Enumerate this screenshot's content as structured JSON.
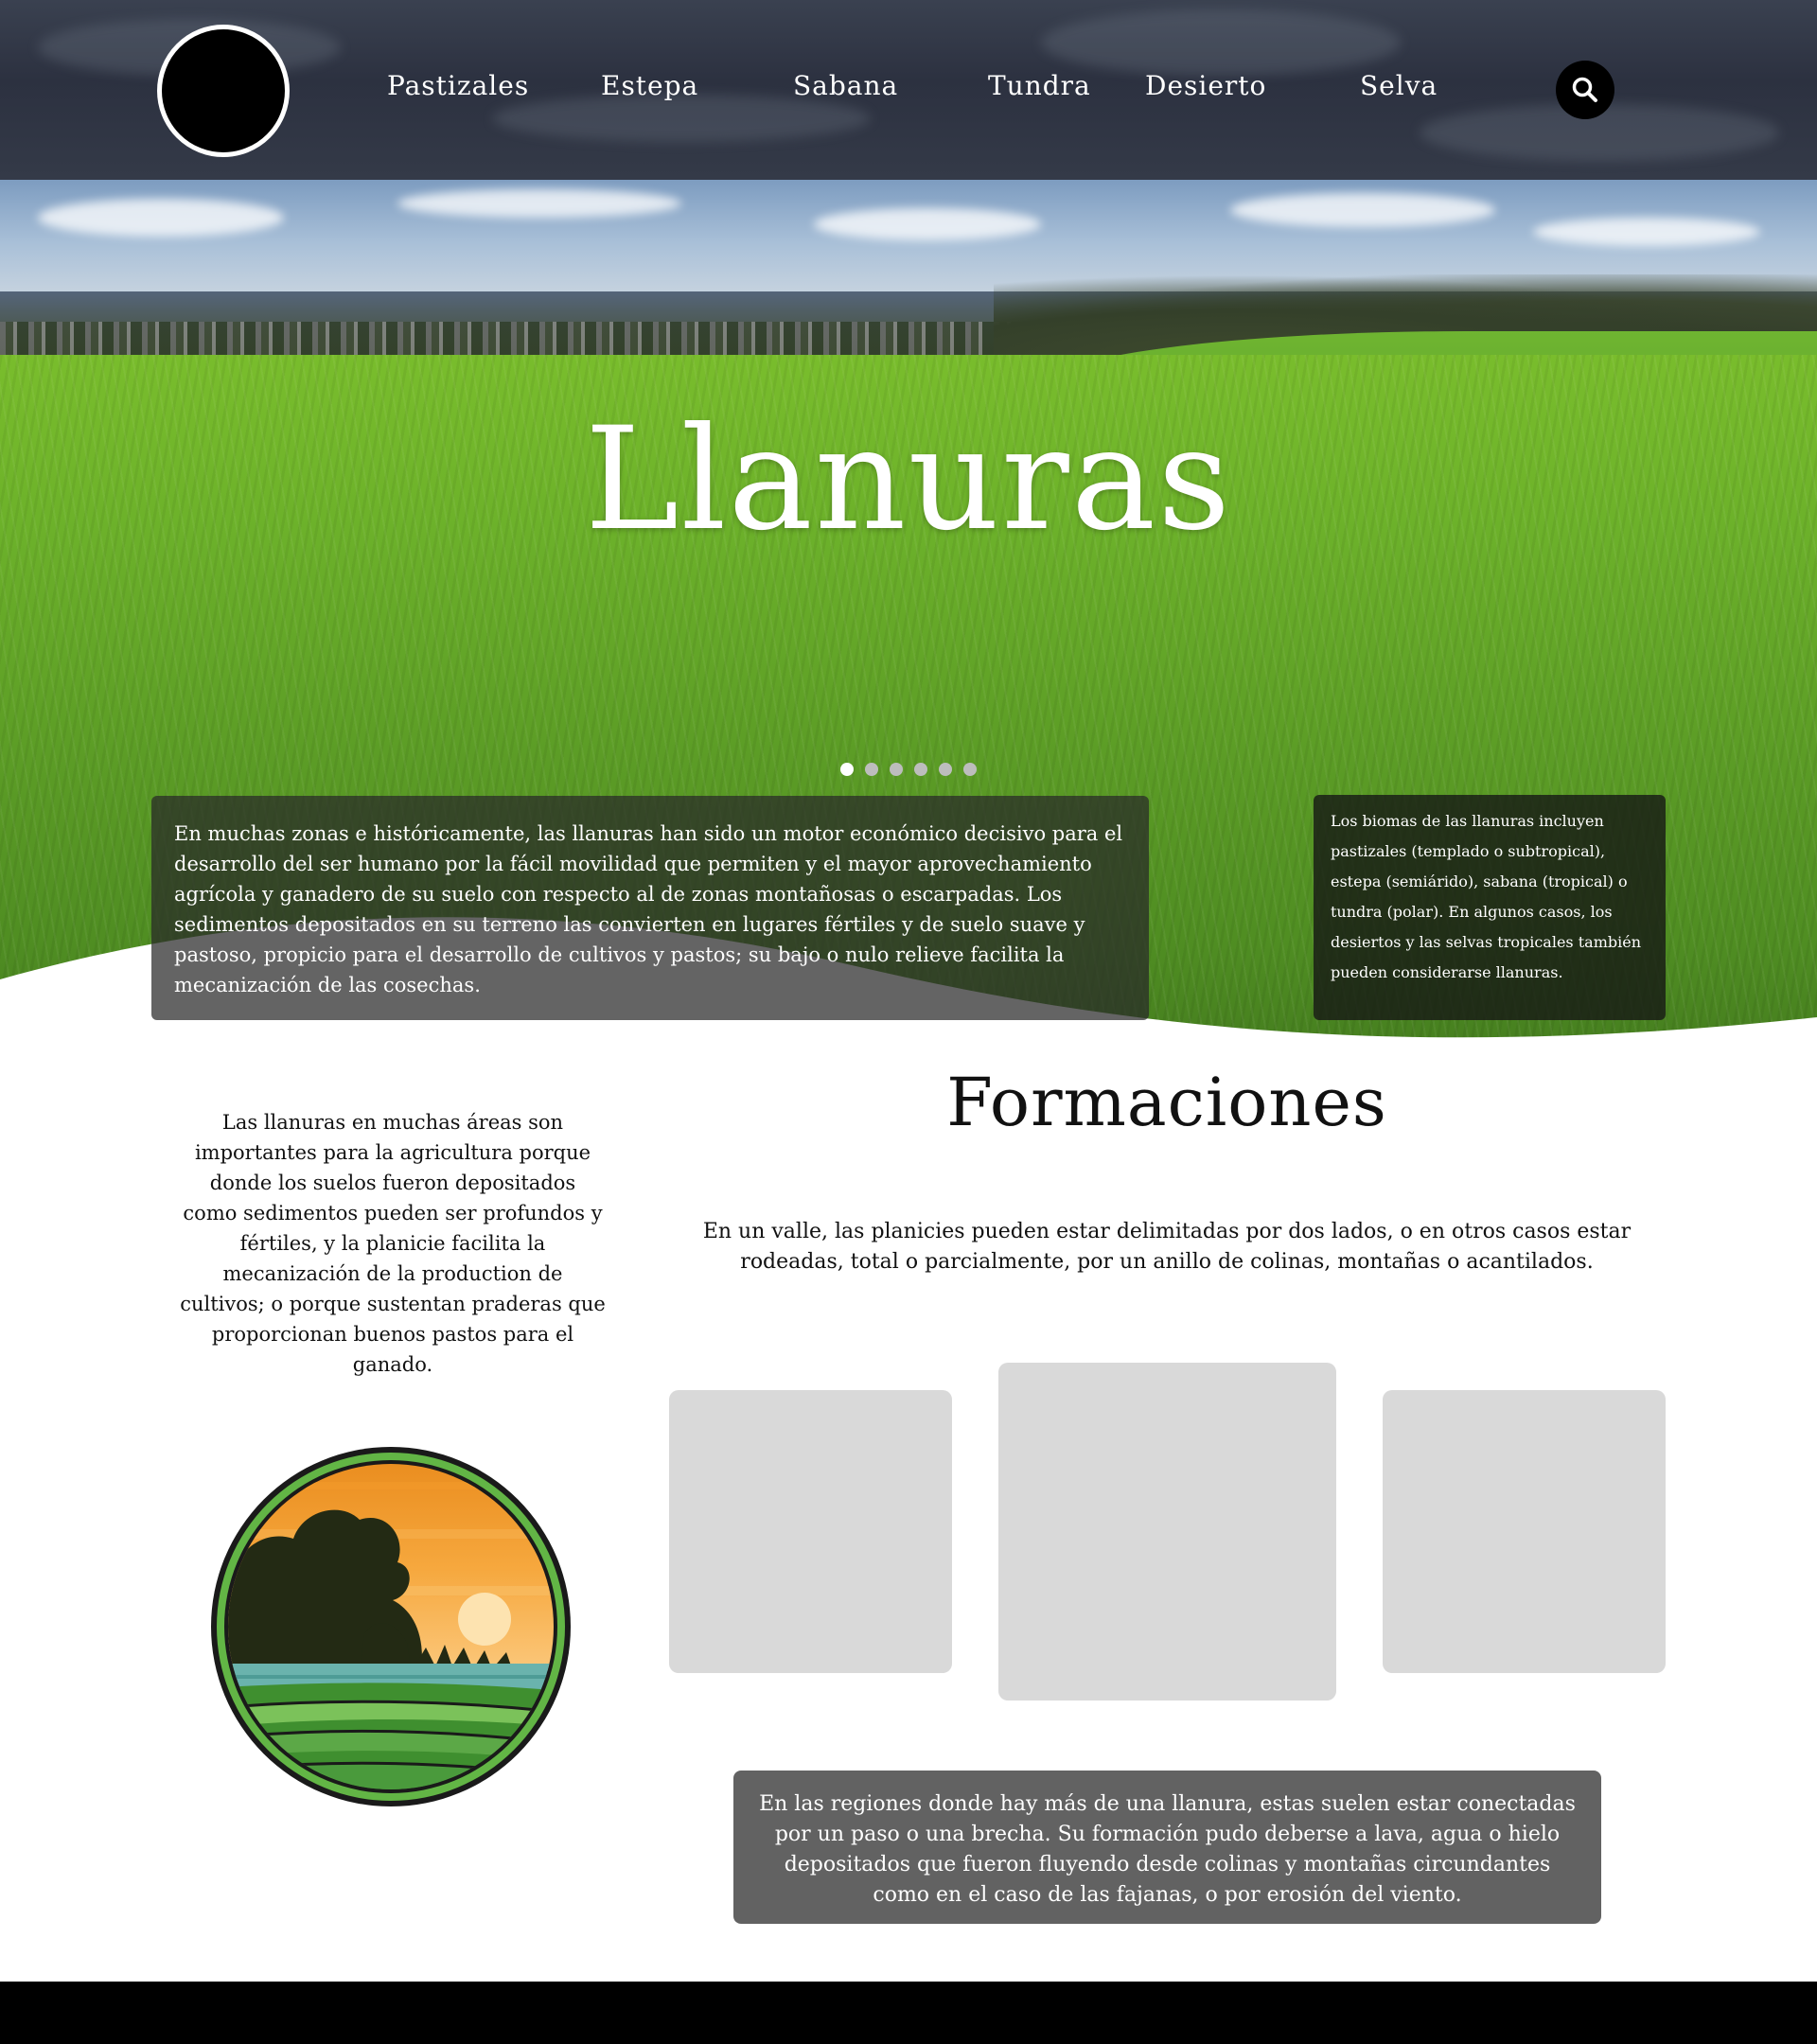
{
  "nav": {
    "items": [
      "Pastizales",
      "Estepa",
      "Sabana",
      "Tundra",
      "Desierto",
      "Selva"
    ],
    "search_icon": "search-icon",
    "logo_icon": "logo-circle"
  },
  "hero": {
    "title": "Llanuras",
    "slides_total": 6,
    "active_slide": 1,
    "left_text": "En muchas zonas e históricamente, las llanuras han sido un motor económico decisivo para el desarrollo del ser humano por la fácil movilidad que permiten y el mayor aprovechamiento agrícola y ganadero de su suelo con respecto al de zonas montañosas o escarpadas. Los sedimentos depositados en su terreno las convierten en lugares fértiles y de suelo suave y pastoso, propicio para el desarrollo de cultivos y pastos; su bajo o nulo relieve facilita la mecanización de las cosechas.",
    "right_text": "Los biomas de las llanuras incluyen pastizales (templado o subtropical), estepa (semiárido), sabana (tropical) o tundra (polar). En algunos casos, los desiertos y las selvas tropicales también pueden considerarse llanuras."
  },
  "main": {
    "left_text": "Las llanuras en muchas áreas son importantes para la agricultura porque donde los suelos fueron depositados como sedimentos pueden ser profundos y fértiles, y la planicie facilita la mecanización de la production de cultivos; o porque sustentan praderas que proporcionan buenos pastos para el ganado.",
    "emblem_icon": "plains-landscape-emblem",
    "section_title": "Formaciones",
    "section_desc": "En un valle, las planicies pueden estar delimitadas por dos lados, o en otros casos estar rodeadas, total o parcialmente, por un anillo de colinas, montañas o acantilados.",
    "bottom_text": "En las regiones donde hay más de una llanura, estas suelen estar conectadas por un paso o una brecha. Su formación pudo deberse a lava, agua o hielo depositados que fueron fluyendo desde colinas y montañas circundantes como en el caso de las fajanas, o por erosión del viento."
  },
  "colors": {
    "header_bg": "#2c3140",
    "grass": "#6cb12a",
    "placeholder": "#d9d9d9",
    "card_gray": "#626262",
    "footer": "#000000"
  }
}
